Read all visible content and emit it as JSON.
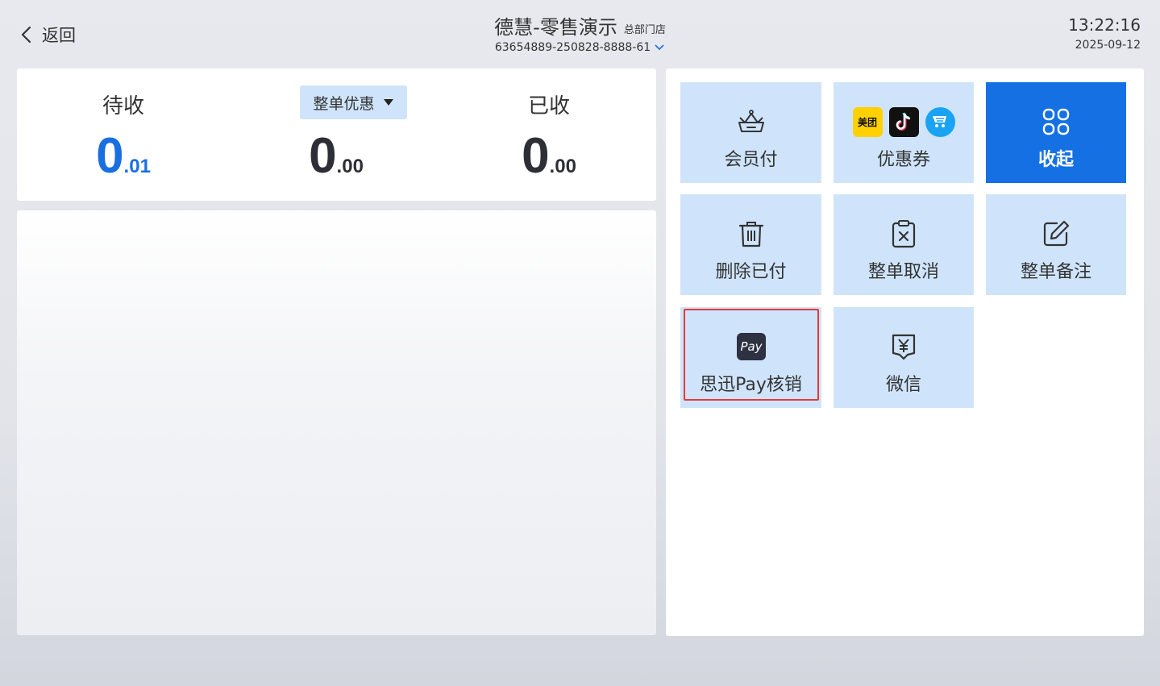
{
  "header": {
    "back_label": "返回",
    "store_title": "德慧-零售演示",
    "store_branch": "总部门店",
    "order_id": "63654889-250828-8888-61",
    "time": "13:22:16",
    "date": "2025-09-12"
  },
  "summary": {
    "pending_label": "待收",
    "pending_int": "0",
    "pending_dec": ".01",
    "discount_label": "整单优惠",
    "discount_int": "0",
    "discount_dec": ".00",
    "received_label": "已收",
    "received_int": "0",
    "received_dec": ".00"
  },
  "actions": {
    "member_pay": "会员付",
    "coupon": "优惠券",
    "coupon_meituan": "美团",
    "collapse": "收起",
    "delete_paid": "删除已付",
    "cancel_order": "整单取消",
    "order_note": "整单备注",
    "sixun_pay": "思迅Pay核销",
    "pay_badge": "Pay",
    "wechat": "微信"
  },
  "colors": {
    "accent": "#1570e4",
    "tile_bg": "#cfe4fb",
    "amount_blue": "#1a6fe0",
    "highlight_border": "#e23b3b"
  },
  "icons": {
    "back": "chevron-left-icon",
    "member_pay": "crown-basket-icon",
    "collapse": "grid-four-icon",
    "delete_paid": "trash-icon",
    "cancel_order": "clipboard-x-icon",
    "order_note": "edit-note-icon",
    "sixun_pay": "pay-badge-icon",
    "wechat": "yen-shield-icon"
  }
}
